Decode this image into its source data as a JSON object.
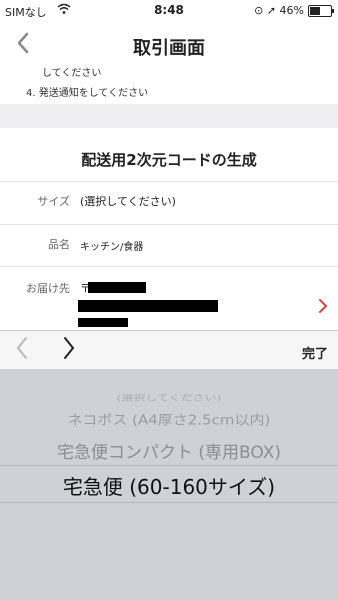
{
  "status_bar": {
    "carrier": "SIMなし",
    "time": "8:48",
    "battery_percent": "46%",
    "battery_level": 0.46
  },
  "nav": {
    "back_icon": "chevron-left",
    "title": "取引画面"
  },
  "steps": {
    "step3_tail": "してください",
    "step4": "4.  発送通知をしてください"
  },
  "form": {
    "heading": "配送用2次元コードの生成",
    "size_label": "サイズ",
    "size_value": "(選択してください)",
    "category_label": "品名",
    "category_value": "キッチン/食器",
    "address_label": "お届け先",
    "address_prefix": "〒"
  },
  "toolbar": {
    "prev_icon": "chevron-left",
    "next_icon": "chevron-right",
    "done_label": "完了"
  },
  "picker": {
    "options": [
      "(選択してください)",
      "ネコポス (A4厚さ2.5cm以内)",
      "宅急便コンパクト (専用BOX)",
      "宅急便 (60-160サイズ)"
    ],
    "selected_index": 3
  },
  "colors": {
    "accent_chevron": "#cc4a4a",
    "picker_bg": "#cfd1d6",
    "section_gap": "#efeff2"
  }
}
